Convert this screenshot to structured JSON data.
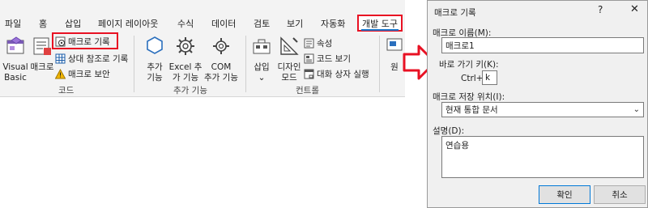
{
  "ribbon": {
    "tabs": [
      "파일",
      "홈",
      "삽입",
      "페이지 레이아웃",
      "수식",
      "데이터",
      "검토",
      "보기",
      "자동화",
      "개발 도구"
    ],
    "code_group": {
      "visual_basic_line1": "Visual",
      "visual_basic_line2": "Basic",
      "macro": "매크로",
      "record_macro": "매크로 기록",
      "relative_ref": "상대 참조로 기록",
      "macro_security": "매크로 보안",
      "label": "코드"
    },
    "addins_group": {
      "addins_line1": "추가",
      "addins_line2": "기능",
      "excel_addins_line1": "Excel 추",
      "excel_addins_line2": "가 기능",
      "com_addins_line1": "COM",
      "com_addins_line2": "추가 기능",
      "label": "추가 기능"
    },
    "controls_group": {
      "insert": "삽입",
      "design_mode_line1": "디자인",
      "design_mode_line2": "모드",
      "properties": "속성",
      "view_code": "코드 보기",
      "run_dialog": "대화 상자 실행",
      "label": "컨트롤"
    },
    "partial_button": "원"
  },
  "dialog": {
    "title": "매크로 기록",
    "help": "?",
    "close": "✕",
    "macro_name_label": "매크로 이름(M):",
    "macro_name_value": "매크로1",
    "shortcut_label": "바로 가기 키(K):",
    "shortcut_prefix": "Ctrl+",
    "shortcut_value": "k",
    "store_label": "매크로 저장 위치(I):",
    "store_value": "현재 통합 문서",
    "description_label": "설명(D):",
    "description_value": "연습용",
    "ok": "확인",
    "cancel": "취소"
  },
  "colors": {
    "highlight_red": "#e81123",
    "accent_blue": "#1a73c7"
  }
}
